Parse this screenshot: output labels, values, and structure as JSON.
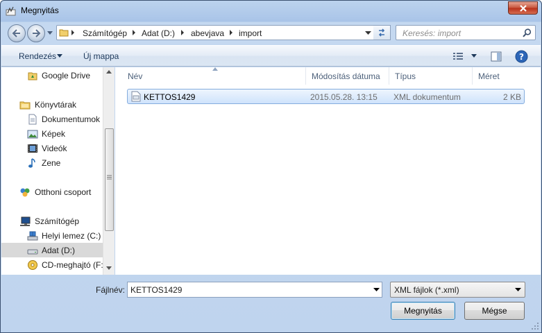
{
  "window": {
    "title": "Megnyitás"
  },
  "address": {
    "crumbs": [
      "Számítógép",
      "Adat (D:)",
      "abevjava",
      "import"
    ]
  },
  "search": {
    "placeholder": "Keresés: import"
  },
  "toolbar": {
    "organize_label": "Rendezés",
    "new_folder_label": "Új mappa"
  },
  "navpane": {
    "items": [
      {
        "label": "Google Drive",
        "icon": "google-drive-icon"
      },
      {
        "label": "Könyvtárak",
        "icon": "libraries-icon"
      },
      {
        "label": "Dokumentumok",
        "icon": "documents-icon"
      },
      {
        "label": "Képek",
        "icon": "pictures-icon"
      },
      {
        "label": "Videók",
        "icon": "videos-icon"
      },
      {
        "label": "Zene",
        "icon": "music-icon"
      },
      {
        "label": "Otthoni csoport",
        "icon": "homegroup-icon"
      },
      {
        "label": "Számítógép",
        "icon": "computer-icon"
      },
      {
        "label": "Helyi lemez (C:)",
        "icon": "local-disk-icon"
      },
      {
        "label": "Adat (D:)",
        "icon": "drive-icon",
        "selected": true
      },
      {
        "label": "CD-meghajtó (F:",
        "icon": "cd-drive-icon"
      }
    ]
  },
  "filelist": {
    "columns": [
      "Név",
      "Módosítás dátuma",
      "Típus",
      "Méret"
    ],
    "rows": [
      {
        "name": "KETTOS1429",
        "date": "2015.05.28. 13:15",
        "type": "XML dokumentum",
        "size": "2 KB",
        "selected": true
      }
    ]
  },
  "footer": {
    "filename_label": "Fájlnév:",
    "filename_value": "KETTOS1429",
    "filetype_value": "XML fájlok (*.xml)",
    "open_label": "Megnyitás",
    "cancel_label": "Mégse"
  },
  "colors": {
    "selection_bg": "#cfe3fc",
    "selection_border": "#84acdd",
    "frame": "#bfd4ee"
  }
}
